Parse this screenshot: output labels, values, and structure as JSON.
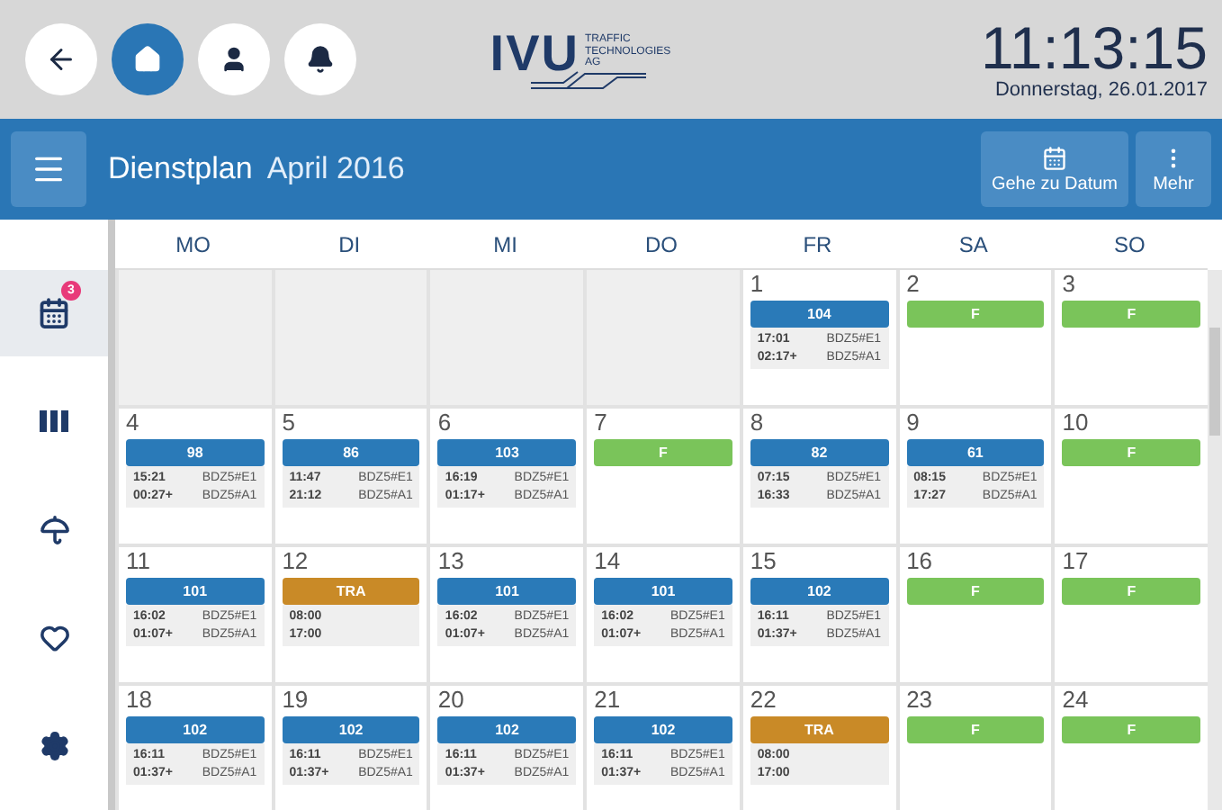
{
  "top_bar": {
    "nav_buttons": [
      {
        "kind": "back",
        "selected": false
      },
      {
        "kind": "home",
        "selected": true
      },
      {
        "kind": "person",
        "selected": false
      },
      {
        "kind": "bell",
        "selected": false
      }
    ],
    "logo": {
      "mark": "IVU",
      "lines": [
        "TRAFFIC",
        "TECHNOLOGIES",
        "AG"
      ]
    },
    "clock": {
      "time": "11:13:15",
      "date": "Donnerstag, 26.01.2017"
    }
  },
  "title_bar": {
    "title": "Dienstplan",
    "subtitle": "April 2016",
    "actions": [
      {
        "kind": "calendar",
        "label": "Gehe zu Datum"
      },
      {
        "kind": "more",
        "label": "Mehr"
      }
    ]
  },
  "sidebar": {
    "items": [
      {
        "kind": "calendar",
        "selected": true,
        "badge": "3"
      },
      {
        "kind": "columns",
        "selected": false
      },
      {
        "kind": "umbrella",
        "selected": false
      },
      {
        "kind": "heart",
        "selected": false
      },
      {
        "kind": "settings",
        "selected": false
      }
    ]
  },
  "calendar": {
    "weekdays": [
      "MO",
      "DI",
      "MI",
      "DO",
      "FR",
      "SA",
      "SO"
    ],
    "weeks": [
      [
        {
          "in_month": false
        },
        {
          "in_month": false
        },
        {
          "in_month": false
        },
        {
          "in_month": false
        },
        {
          "in_month": true,
          "day": "1",
          "duty": {
            "kind": "shift",
            "label": "104",
            "lines": [
              [
                "17:01",
                "BDZ5#E1"
              ],
              [
                "02:17+",
                "BDZ5#A1"
              ]
            ]
          }
        },
        {
          "in_month": true,
          "day": "2",
          "duty": {
            "kind": "free",
            "label": "F"
          }
        },
        {
          "in_month": true,
          "day": "3",
          "duty": {
            "kind": "free",
            "label": "F"
          }
        }
      ],
      [
        {
          "in_month": true,
          "day": "4",
          "duty": {
            "kind": "shift",
            "label": "98",
            "lines": [
              [
                "15:21",
                "BDZ5#E1"
              ],
              [
                "00:27+",
                "BDZ5#A1"
              ]
            ]
          }
        },
        {
          "in_month": true,
          "day": "5",
          "duty": {
            "kind": "shift",
            "label": "86",
            "lines": [
              [
                "11:47",
                "BDZ5#E1"
              ],
              [
                "21:12",
                "BDZ5#A1"
              ]
            ]
          }
        },
        {
          "in_month": true,
          "day": "6",
          "duty": {
            "kind": "shift",
            "label": "103",
            "lines": [
              [
                "16:19",
                "BDZ5#E1"
              ],
              [
                "01:17+",
                "BDZ5#A1"
              ]
            ]
          }
        },
        {
          "in_month": true,
          "day": "7",
          "duty": {
            "kind": "free",
            "label": "F"
          }
        },
        {
          "in_month": true,
          "day": "8",
          "duty": {
            "kind": "shift",
            "label": "82",
            "lines": [
              [
                "07:15",
                "BDZ5#E1"
              ],
              [
                "16:33",
                "BDZ5#A1"
              ]
            ]
          }
        },
        {
          "in_month": true,
          "day": "9",
          "duty": {
            "kind": "shift",
            "label": "61",
            "lines": [
              [
                "08:15",
                "BDZ5#E1"
              ],
              [
                "17:27",
                "BDZ5#A1"
              ]
            ]
          }
        },
        {
          "in_month": true,
          "day": "10",
          "duty": {
            "kind": "free",
            "label": "F"
          }
        }
      ],
      [
        {
          "in_month": true,
          "day": "11",
          "duty": {
            "kind": "shift",
            "label": "101",
            "lines": [
              [
                "16:02",
                "BDZ5#E1"
              ],
              [
                "01:07+",
                "BDZ5#A1"
              ]
            ]
          }
        },
        {
          "in_month": true,
          "day": "12",
          "duty": {
            "kind": "training",
            "label": "TRA",
            "lines": [
              [
                "08:00"
              ],
              [
                "17:00"
              ]
            ]
          }
        },
        {
          "in_month": true,
          "day": "13",
          "duty": {
            "kind": "shift",
            "label": "101",
            "lines": [
              [
                "16:02",
                "BDZ5#E1"
              ],
              [
                "01:07+",
                "BDZ5#A1"
              ]
            ]
          }
        },
        {
          "in_month": true,
          "day": "14",
          "duty": {
            "kind": "shift",
            "label": "101",
            "lines": [
              [
                "16:02",
                "BDZ5#E1"
              ],
              [
                "01:07+",
                "BDZ5#A1"
              ]
            ]
          }
        },
        {
          "in_month": true,
          "day": "15",
          "duty": {
            "kind": "shift",
            "label": "102",
            "lines": [
              [
                "16:11",
                "BDZ5#E1"
              ],
              [
                "01:37+",
                "BDZ5#A1"
              ]
            ]
          }
        },
        {
          "in_month": true,
          "day": "16",
          "duty": {
            "kind": "free",
            "label": "F"
          }
        },
        {
          "in_month": true,
          "day": "17",
          "duty": {
            "kind": "free",
            "label": "F"
          }
        }
      ],
      [
        {
          "in_month": true,
          "day": "18",
          "duty": {
            "kind": "shift",
            "label": "102",
            "lines": [
              [
                "16:11",
                "BDZ5#E1"
              ],
              [
                "01:37+",
                "BDZ5#A1"
              ]
            ]
          }
        },
        {
          "in_month": true,
          "day": "19",
          "duty": {
            "kind": "shift",
            "label": "102",
            "lines": [
              [
                "16:11",
                "BDZ5#E1"
              ],
              [
                "01:37+",
                "BDZ5#A1"
              ]
            ]
          }
        },
        {
          "in_month": true,
          "day": "20",
          "duty": {
            "kind": "shift",
            "label": "102",
            "lines": [
              [
                "16:11",
                "BDZ5#E1"
              ],
              [
                "01:37+",
                "BDZ5#A1"
              ]
            ]
          }
        },
        {
          "in_month": true,
          "day": "21",
          "duty": {
            "kind": "shift",
            "label": "102",
            "lines": [
              [
                "16:11",
                "BDZ5#E1"
              ],
              [
                "01:37+",
                "BDZ5#A1"
              ]
            ]
          }
        },
        {
          "in_month": true,
          "day": "22",
          "duty": {
            "kind": "training",
            "label": "TRA",
            "lines": [
              [
                "08:00"
              ],
              [
                "17:00"
              ]
            ]
          }
        },
        {
          "in_month": true,
          "day": "23",
          "duty": {
            "kind": "free",
            "label": "F"
          }
        },
        {
          "in_month": true,
          "day": "24",
          "duty": {
            "kind": "free",
            "label": "F"
          }
        }
      ]
    ]
  }
}
